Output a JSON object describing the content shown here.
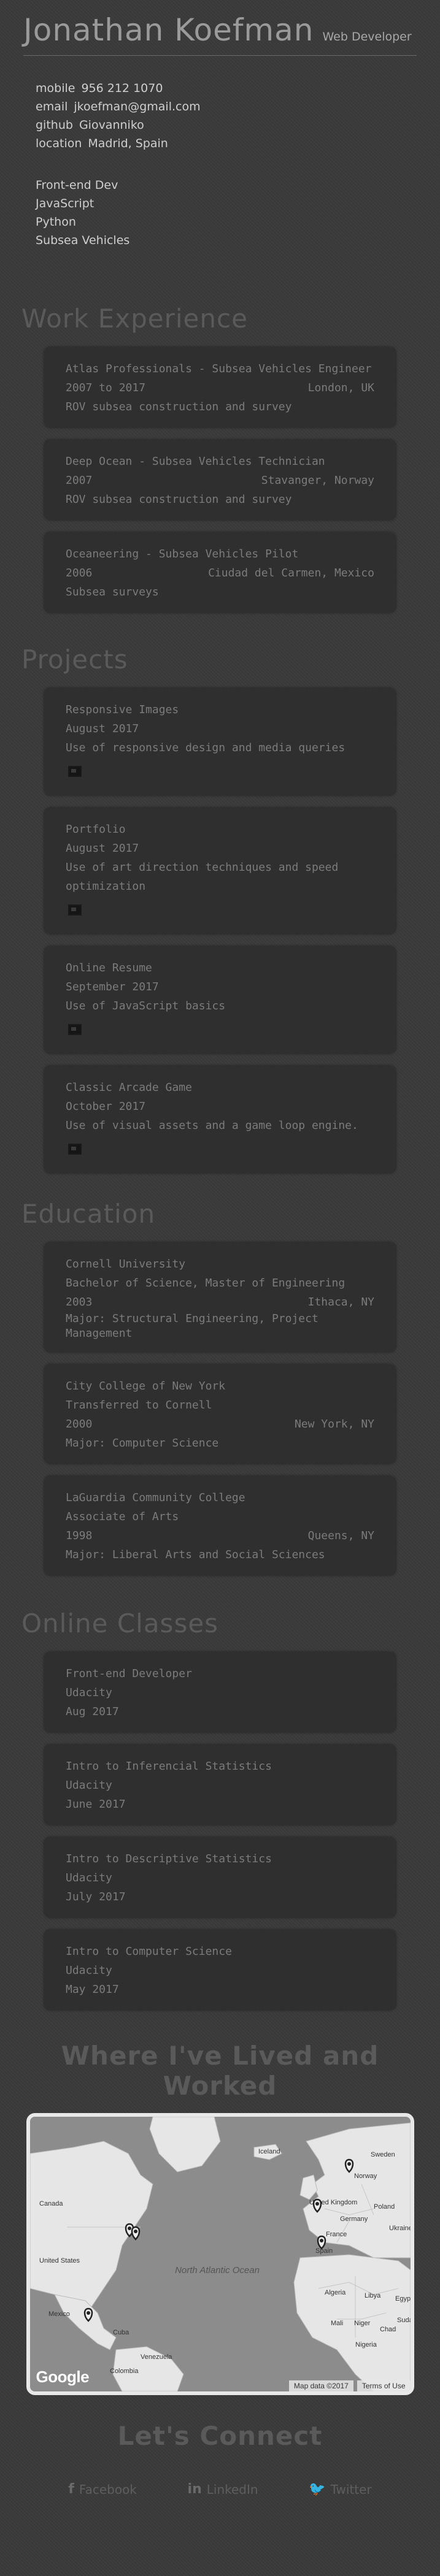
{
  "header": {
    "name": "Jonathan Koefman",
    "role": "Web Developer",
    "contacts": [
      {
        "label": "mobile",
        "value": "956 212 1070"
      },
      {
        "label": "email",
        "value": "jkoefman@gmail.com"
      },
      {
        "label": "github",
        "value": "Giovanniko"
      },
      {
        "label": "location",
        "value": "Madrid, Spain"
      }
    ],
    "skills": [
      "Front-end Dev",
      "JavaScript",
      "Python",
      "Subsea Vehicles"
    ]
  },
  "work": {
    "title": "Work Experience",
    "items": [
      {
        "title": "Atlas Professionals - Subsea Vehicles Engineer",
        "dates": "2007 to 2017",
        "location": "London, UK",
        "description": "ROV subsea construction and survey"
      },
      {
        "title": "Deep Ocean - Subsea Vehicles Technician",
        "dates": "2007",
        "location": "Stavanger, Norway",
        "description": "ROV subsea construction and survey"
      },
      {
        "title": "Oceaneering - Subsea Vehicles Pilot",
        "dates": "2006",
        "location": "Ciudad del Carmen, Mexico",
        "description": "Subsea surveys"
      }
    ]
  },
  "projects": {
    "title": "Projects",
    "items": [
      {
        "title": "Responsive Images",
        "date": "August 2017",
        "description": "Use of responsive design and media queries",
        "icon": "image-icon"
      },
      {
        "title": "Portfolio",
        "date": "August 2017",
        "description": "Use of art direction techniques and speed optimization",
        "icon": "image-icon"
      },
      {
        "title": "Online Resume",
        "date": "September 2017",
        "description": "Use of JavaScript basics",
        "icon": "image-icon"
      },
      {
        "title": "Classic Arcade Game",
        "date": "October 2017",
        "description": "Use of visual assets and a game loop engine.",
        "icon": "image-icon"
      }
    ]
  },
  "education": {
    "title": "Education",
    "items": [
      {
        "school": "Cornell University",
        "degree": "Bachelor of Science, Master of Engineering",
        "year": "2003",
        "location": "Ithaca, NY",
        "major": "Major: Structural Engineering, Project Management"
      },
      {
        "school": "City College of New York",
        "degree": "Transferred to Cornell",
        "year": "2000",
        "location": "New York, NY",
        "major": "Major: Computer Science"
      },
      {
        "school": "LaGuardia Community College",
        "degree": "Associate of Arts",
        "year": "1998",
        "location": "Queens, NY",
        "major": "Major: Liberal Arts and Social Sciences"
      }
    ]
  },
  "online": {
    "title": "Online Classes",
    "items": [
      {
        "course": "Front-end Developer",
        "school": "Udacity",
        "date": "Aug 2017"
      },
      {
        "course": "Intro to Inferencial Statistics",
        "school": "Udacity",
        "date": "June 2017"
      },
      {
        "course": "Intro to Descriptive Statistics",
        "school": "Udacity",
        "date": "July 2017"
      },
      {
        "course": "Intro to Computer Science",
        "school": "Udacity",
        "date": "May 2017"
      }
    ]
  },
  "map": {
    "title": "Where I've Lived and Worked",
    "labels": {
      "iceland": "Iceland",
      "norway": "Norway",
      "sweden": "Sweden",
      "canada": "Canada",
      "us": "United States",
      "uk": "United Kingdom",
      "germany": "Germany",
      "poland": "Poland",
      "ukraine": "Ukraine",
      "france": "France",
      "spain": "Spain",
      "mexico": "Mexico",
      "atlantic": "North Atlantic Ocean",
      "cuba": "Cuba",
      "venezuela": "Venezuela",
      "colombia": "Colombia",
      "algeria": "Algeria",
      "libya": "Libya",
      "egypt": "Egypt",
      "mali": "Mali",
      "niger": "Niger",
      "chad": "Chad",
      "sudan": "Sudan",
      "nigeria": "Nigeria"
    },
    "logo": "Google",
    "map_data": "Map data ©2017",
    "terms": "Terms of Use"
  },
  "connect": {
    "title": "Let's Connect",
    "links": [
      {
        "icon": "facebook-icon",
        "glyph": "f",
        "label": "Facebook"
      },
      {
        "icon": "linkedin-icon",
        "glyph": "in",
        "label": "LinkedIn"
      },
      {
        "icon": "twitter-icon",
        "glyph": "🐦",
        "label": "Twitter"
      }
    ]
  }
}
